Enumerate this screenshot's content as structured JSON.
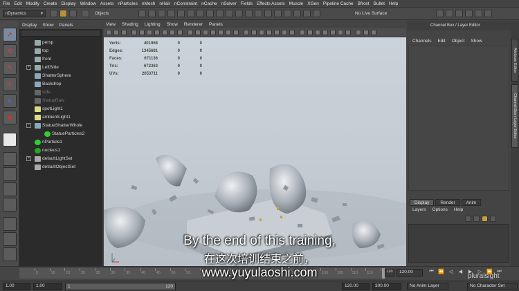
{
  "menubar": {
    "items": [
      "File",
      "Edit",
      "Modify",
      "Create",
      "Display",
      "Window",
      "Assets",
      "nParticles",
      "nMesh",
      "nHair",
      "nConstraint",
      "nCache",
      "nSolver",
      "Fields",
      "Effects Assets",
      "Muscle",
      "XGen",
      "Pipeline Cache",
      "Bfrost",
      "Bullet",
      "Help"
    ]
  },
  "statusline": {
    "menu_set": "nDynamics",
    "objects_label": "Objects",
    "live_surface": "No Live Surface"
  },
  "outliner": {
    "menu": [
      "Display",
      "Show",
      "Panels"
    ],
    "items": [
      {
        "label": "persp",
        "kind": "camera",
        "expand": ""
      },
      {
        "label": "top",
        "kind": "camera",
        "expand": ""
      },
      {
        "label": "front",
        "kind": "camera",
        "expand": ""
      },
      {
        "label": "LeftSide",
        "kind": "camera",
        "expand": "+"
      },
      {
        "label": "ShatterSphere",
        "kind": "mesh",
        "expand": ""
      },
      {
        "label": "Backdrop",
        "kind": "mesh",
        "expand": ""
      },
      {
        "label": "side",
        "kind": "camera-hidden",
        "expand": ""
      },
      {
        "label": "StatueRaw",
        "kind": "mesh-hidden",
        "expand": ""
      },
      {
        "label": "spotLight1",
        "kind": "light",
        "expand": ""
      },
      {
        "label": "ambientLight1",
        "kind": "light",
        "expand": ""
      },
      {
        "label": "StatueShatterWhole",
        "kind": "mesh",
        "expand": "-"
      },
      {
        "label": "StatueParticles2",
        "kind": "particle-child",
        "expand": ""
      },
      {
        "label": "nParticle1",
        "kind": "particle",
        "expand": ""
      },
      {
        "label": "nucleus1",
        "kind": "nucleus",
        "expand": ""
      },
      {
        "label": "defaultLightSet",
        "kind": "set",
        "expand": "+"
      },
      {
        "label": "defaultObjectSet",
        "kind": "set",
        "expand": ""
      }
    ]
  },
  "viewport": {
    "menu": [
      "View",
      "Shading",
      "Lighting",
      "Show",
      "Renderer",
      "Panels"
    ],
    "hud": [
      {
        "label": "Verts:",
        "value": "401968",
        "b": "0",
        "c": "0"
      },
      {
        "label": "Edges:",
        "value": "1345681",
        "b": "0",
        "c": "0"
      },
      {
        "label": "Faces:",
        "value": "671136",
        "b": "0",
        "c": "0"
      },
      {
        "label": "Tris:",
        "value": "672363",
        "b": "0",
        "c": "0"
      },
      {
        "label": "UVs:",
        "value": "2053711",
        "b": "0",
        "c": "0"
      }
    ]
  },
  "subtitles": {
    "line1": "By the end of this training,",
    "line2": "在这次培训结束之前，",
    "line3": "www.yuyulaoshi.com"
  },
  "channelbox": {
    "title": "Channel Box / Layer Editor",
    "menu": [
      "Channels",
      "Edit",
      "Object",
      "Show"
    ],
    "layer_tabs": [
      "Display",
      "Render",
      "Anim"
    ],
    "active_tab": "Display",
    "layer_menu": [
      "Layers",
      "Options",
      "Help"
    ],
    "side_tabs": [
      "Attribute Editor",
      "Channel Box / Layer Editor"
    ]
  },
  "timeslider": {
    "ticks": [
      "5",
      "10",
      "15",
      "20",
      "25",
      "30",
      "35",
      "40",
      "45",
      "50",
      "55",
      "60",
      "65",
      "70",
      "75",
      "80",
      "85",
      "90",
      "95",
      "100",
      "105",
      "110",
      "115",
      "120"
    ],
    "current_frame": "120.00",
    "end_marker": "120"
  },
  "rangeslider": {
    "start_time": "1.00",
    "playback_start": "1.00",
    "range_start": "1",
    "range_end": "120",
    "playback_end": "120.00",
    "end_time": "300.00",
    "anim_layer": "No Anim Layer",
    "character_set": "No Character Set"
  },
  "branding": {
    "logo": "pluralsight"
  },
  "colors": {
    "selection_highlight": "#5a7fa8",
    "hud_text": "#3b4a3e",
    "scene_bg": "#c7cdd5"
  }
}
